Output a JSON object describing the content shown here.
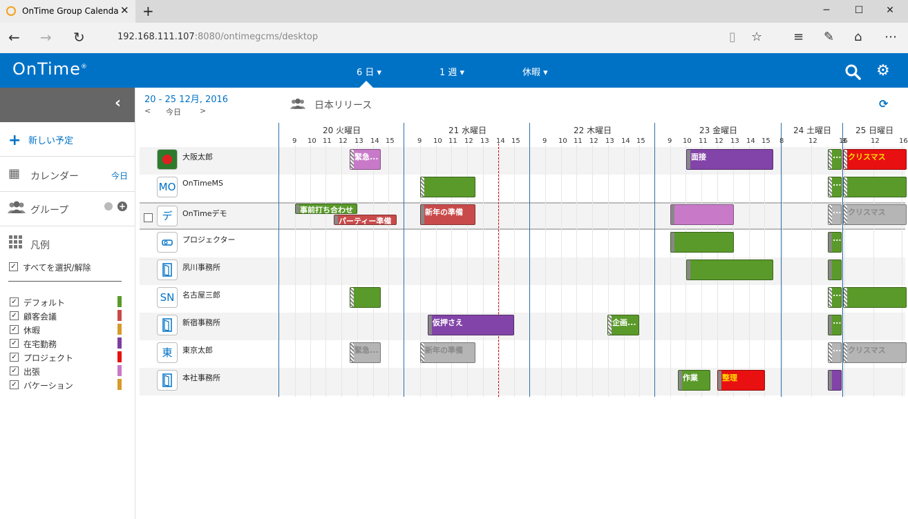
{
  "browser": {
    "tab_title": "OnTime Group Calenda",
    "url_host": "192.168.111.107",
    "url_rest": ":8080/ontimegcms/desktop",
    "icons": [
      "back-icon",
      "forward-icon",
      "refresh-icon",
      "reading-view-icon",
      "favorite-icon",
      "hub-icon",
      "note-icon",
      "share-icon",
      "more-icon"
    ]
  },
  "header": {
    "logo": "OnTime",
    "logo_mark": "®",
    "views": [
      {
        "label": "6 日 ▾"
      },
      {
        "label": "1 週 ▾"
      },
      {
        "label": "休暇 ▾"
      }
    ],
    "bg_color": "#0072c6"
  },
  "sidebar": {
    "new_event": "新しい予定",
    "calendar": "カレンダー",
    "today_link": "今日",
    "group": "グループ",
    "legend": "凡例",
    "select_all": "すべてを選択/解除",
    "legend_items": [
      {
        "label": "デフォルト",
        "color": "#5a9a2a"
      },
      {
        "label": "顧客会議",
        "color": "#c94a4a"
      },
      {
        "label": "休暇",
        "color": "#d89a2a"
      },
      {
        "label": "在宅勤務",
        "color": "#7b3fa0"
      },
      {
        "label": "プロジェクト",
        "color": "#e81010"
      },
      {
        "label": "出張",
        "color": "#c87ac8"
      },
      {
        "label": "バケーション",
        "color": "#d89a2a"
      }
    ]
  },
  "main": {
    "date_range": "20 - 25 12月, 2016",
    "prev": "<",
    "today": "今日",
    "next": ">",
    "group_name": "日本リリース"
  },
  "days": [
    {
      "label": "20 火曜日",
      "hours": [
        "9",
        "10",
        "11",
        "12",
        "13",
        "14",
        "15"
      ]
    },
    {
      "label": "21 水曜日",
      "hours": [
        "9",
        "10",
        "11",
        "12",
        "13",
        "14",
        "15"
      ]
    },
    {
      "label": "22 木曜日",
      "hours": [
        "9",
        "10",
        "11",
        "12",
        "13",
        "14",
        "15"
      ]
    },
    {
      "label": "23 金曜日",
      "hours": [
        "9",
        "10",
        "11",
        "12",
        "13",
        "14",
        "15"
      ]
    },
    {
      "label": "24 土曜日",
      "hours": [
        "8",
        "12",
        "16"
      ]
    },
    {
      "label": "25 日曜日",
      "hours": [
        "8",
        "12",
        "16"
      ]
    }
  ],
  "people": [
    {
      "name": "大阪太郎",
      "avatar": ""
    },
    {
      "name": "OnTimeMS",
      "avatar": "MO"
    },
    {
      "name": "OnTimeデモ",
      "avatar": "デオ"
    },
    {
      "name": "プロジェクター",
      "avatar": ""
    },
    {
      "name": "夙川事務所",
      "avatar": ""
    },
    {
      "name": "名古屋三郎",
      "avatar": "SN"
    },
    {
      "name": "新宿事務所",
      "avatar": ""
    },
    {
      "name": "東京太郎",
      "avatar": "東京"
    },
    {
      "name": "本社事務所",
      "avatar": ""
    }
  ],
  "events": {
    "urgent": "緊急...",
    "interview": "面接",
    "christmas": "クリスマス",
    "preliminary_meeting": "事前打ち合わせ",
    "party_prep": "パーティー準備",
    "new_year_prep": "新年の準備",
    "hold": "仮押さえ",
    "planning": "企画...",
    "work": "作業",
    "arrange": "整理",
    "ellipsis": "..."
  },
  "colors": {
    "green": "#5a9a2a",
    "purple": "#8244a8",
    "pink": "#c87ac8",
    "red": "#c94a4a",
    "bright_red": "#e81010",
    "gray": "#b5b5b5"
  }
}
